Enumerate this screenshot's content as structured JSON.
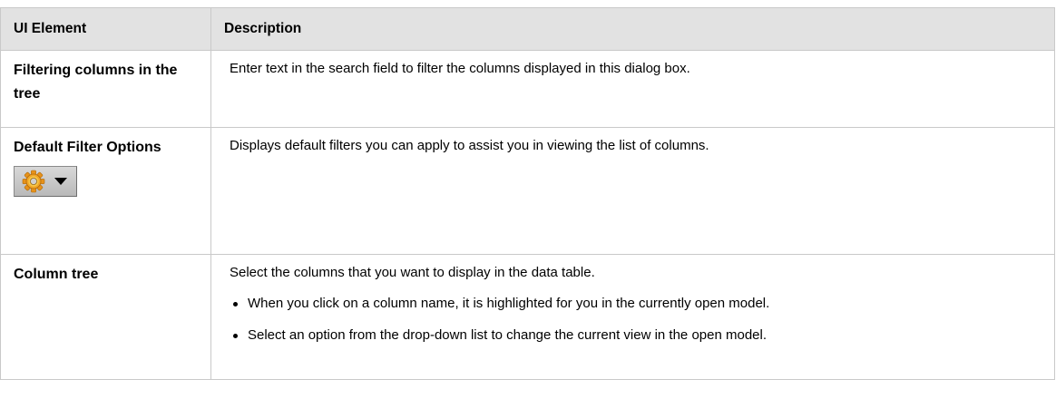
{
  "table": {
    "headers": {
      "ui_element": "UI Element",
      "description": "Description"
    },
    "rows": [
      {
        "element": "Filtering columns in the tree",
        "description": "Enter text in the search field to filter the columns displayed in this dialog box."
      },
      {
        "element": "Default Filter Options",
        "description": "Displays default filters you can apply to assist you in viewing the list of columns.",
        "button_icons": [
          "gear-icon",
          "dropdown-arrow-icon"
        ],
        "icon_color": "#f0a020"
      },
      {
        "element": "Column tree",
        "description": "Select the columns that you want to display in the data table.",
        "bullets": [
          "When you click on a column name, it is highlighted for you in the currently open model.",
          "Select an option from the drop-down list to change the current view in the open model."
        ]
      }
    ]
  }
}
